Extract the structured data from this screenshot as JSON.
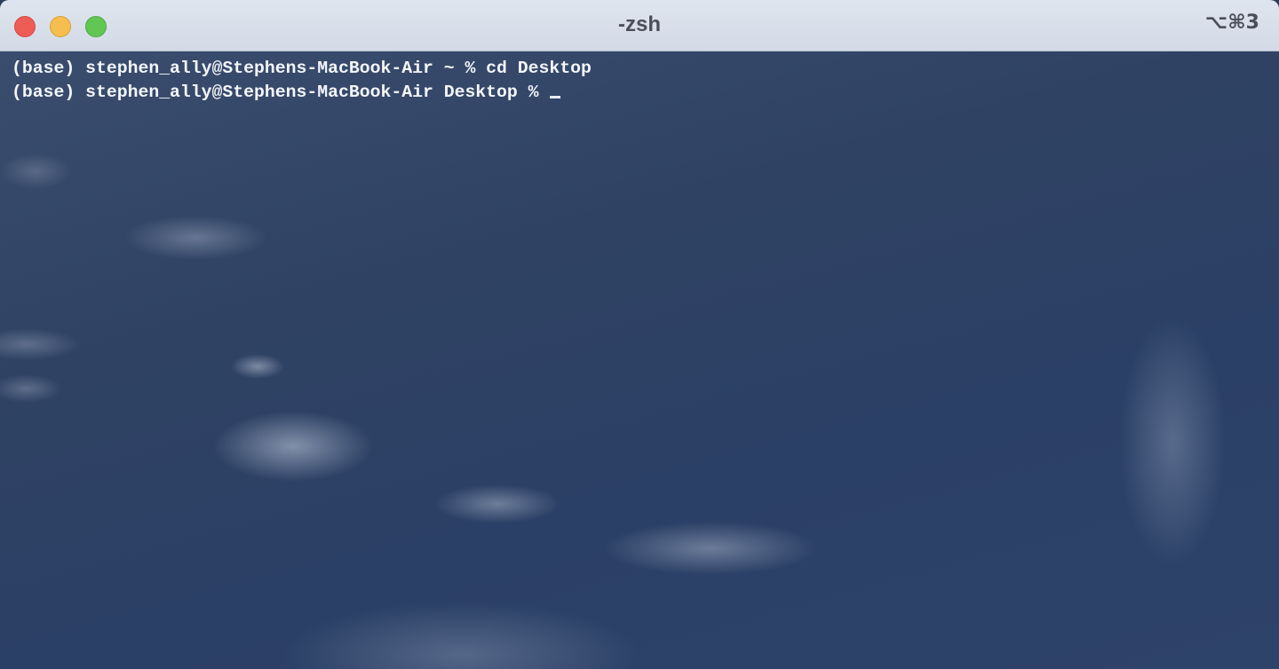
{
  "window": {
    "title": "-zsh",
    "shortcut": "⌥⌘3"
  },
  "terminal": {
    "lines": [
      "(base) stephen_ally@Stephens-MacBook-Air ~ % cd Desktop",
      "(base) stephen_ally@Stephens-MacBook-Air Desktop % "
    ]
  },
  "colors": {
    "close": "#ee5d55",
    "minimize": "#f5be4f",
    "zoom": "#62c655",
    "terminal_text": "#f4f6fa"
  }
}
